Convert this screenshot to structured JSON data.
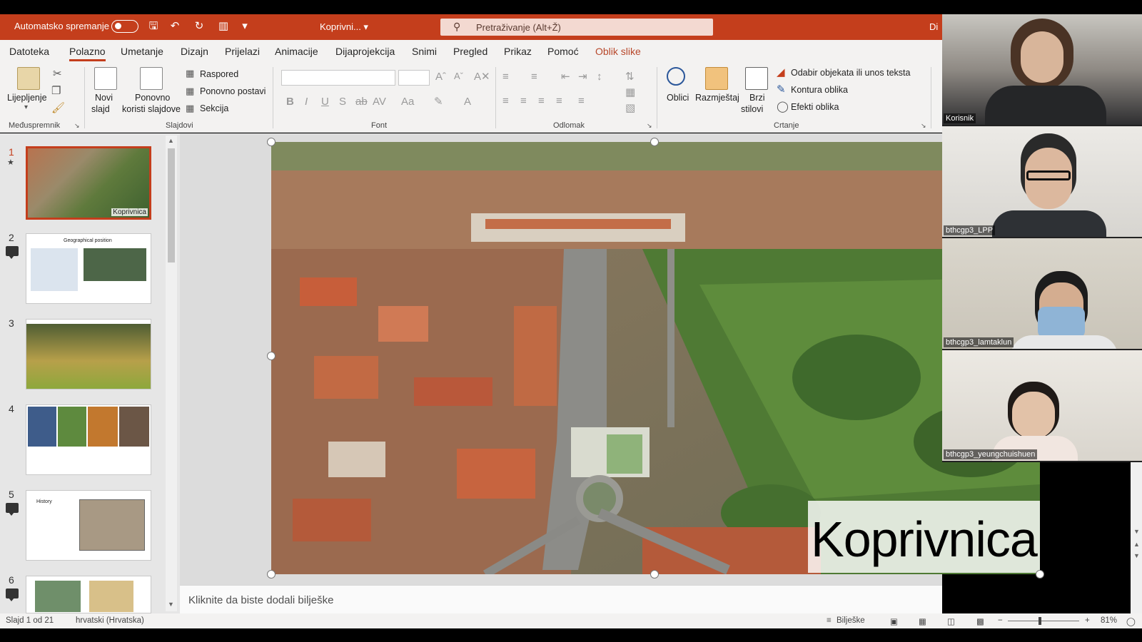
{
  "titlebar": {
    "autosave_label": "Automatsko spremanje",
    "doc_title": "Koprivni...",
    "search_placeholder": "Pretraživanje (Alt+Ž)",
    "user_initials": "Di"
  },
  "tabs": [
    "Datoteka",
    "Polazno",
    "Umetanje",
    "Dizajn",
    "Prijelazi",
    "Animacije",
    "Dijaprojekcija",
    "Snimi",
    "Pregled",
    "Prikaz",
    "Pomoć",
    "Oblik slike"
  ],
  "ribbon": {
    "groups": {
      "clipboard": "Međuspremnik",
      "slides": "Slajdovi",
      "font": "Font",
      "paragraph": "Odlomak",
      "drawing": "Crtanje"
    },
    "paste": "Lijepljenje",
    "new_slide_1": "Novi",
    "new_slide_2": "slajd",
    "reuse_1": "Ponovno",
    "reuse_2": "koristi slajdove",
    "layout": "Raspored",
    "reset": "Ponovno postavi",
    "section": "Sekcija",
    "shapes": "Oblici",
    "arrange": "Razmještaj",
    "quick_styles_1": "Brzi",
    "quick_styles_2": "stilovi",
    "select_objects": "Odabir objekata ili unos teksta",
    "shape_outline": "Kontura oblika",
    "shape_effects": "Efekti oblika"
  },
  "thumbnails": [
    {
      "num": "1",
      "caption": "Koprivnica"
    },
    {
      "num": "2",
      "title": "Geographical position"
    },
    {
      "num": "3"
    },
    {
      "num": "4"
    },
    {
      "num": "5",
      "title": "History"
    },
    {
      "num": "6"
    }
  ],
  "slide": {
    "caption": "Koprivnica"
  },
  "notes_placeholder": "Kliknite da biste dodali bilješke",
  "status": {
    "slide_count": "Slajd 1 od 21",
    "language": "hrvatski (Hrvatska)",
    "notes_button": "Bilješke",
    "zoom": "81%"
  },
  "participants": [
    "Korisnik",
    "bthcgp3_LPP",
    "bthcgp3_lamtaklun",
    "bthcgp3_yeungchuishuen"
  ],
  "colors": {
    "accent": "#c43e1c",
    "ribbon_bg": "#f3f2f1"
  }
}
